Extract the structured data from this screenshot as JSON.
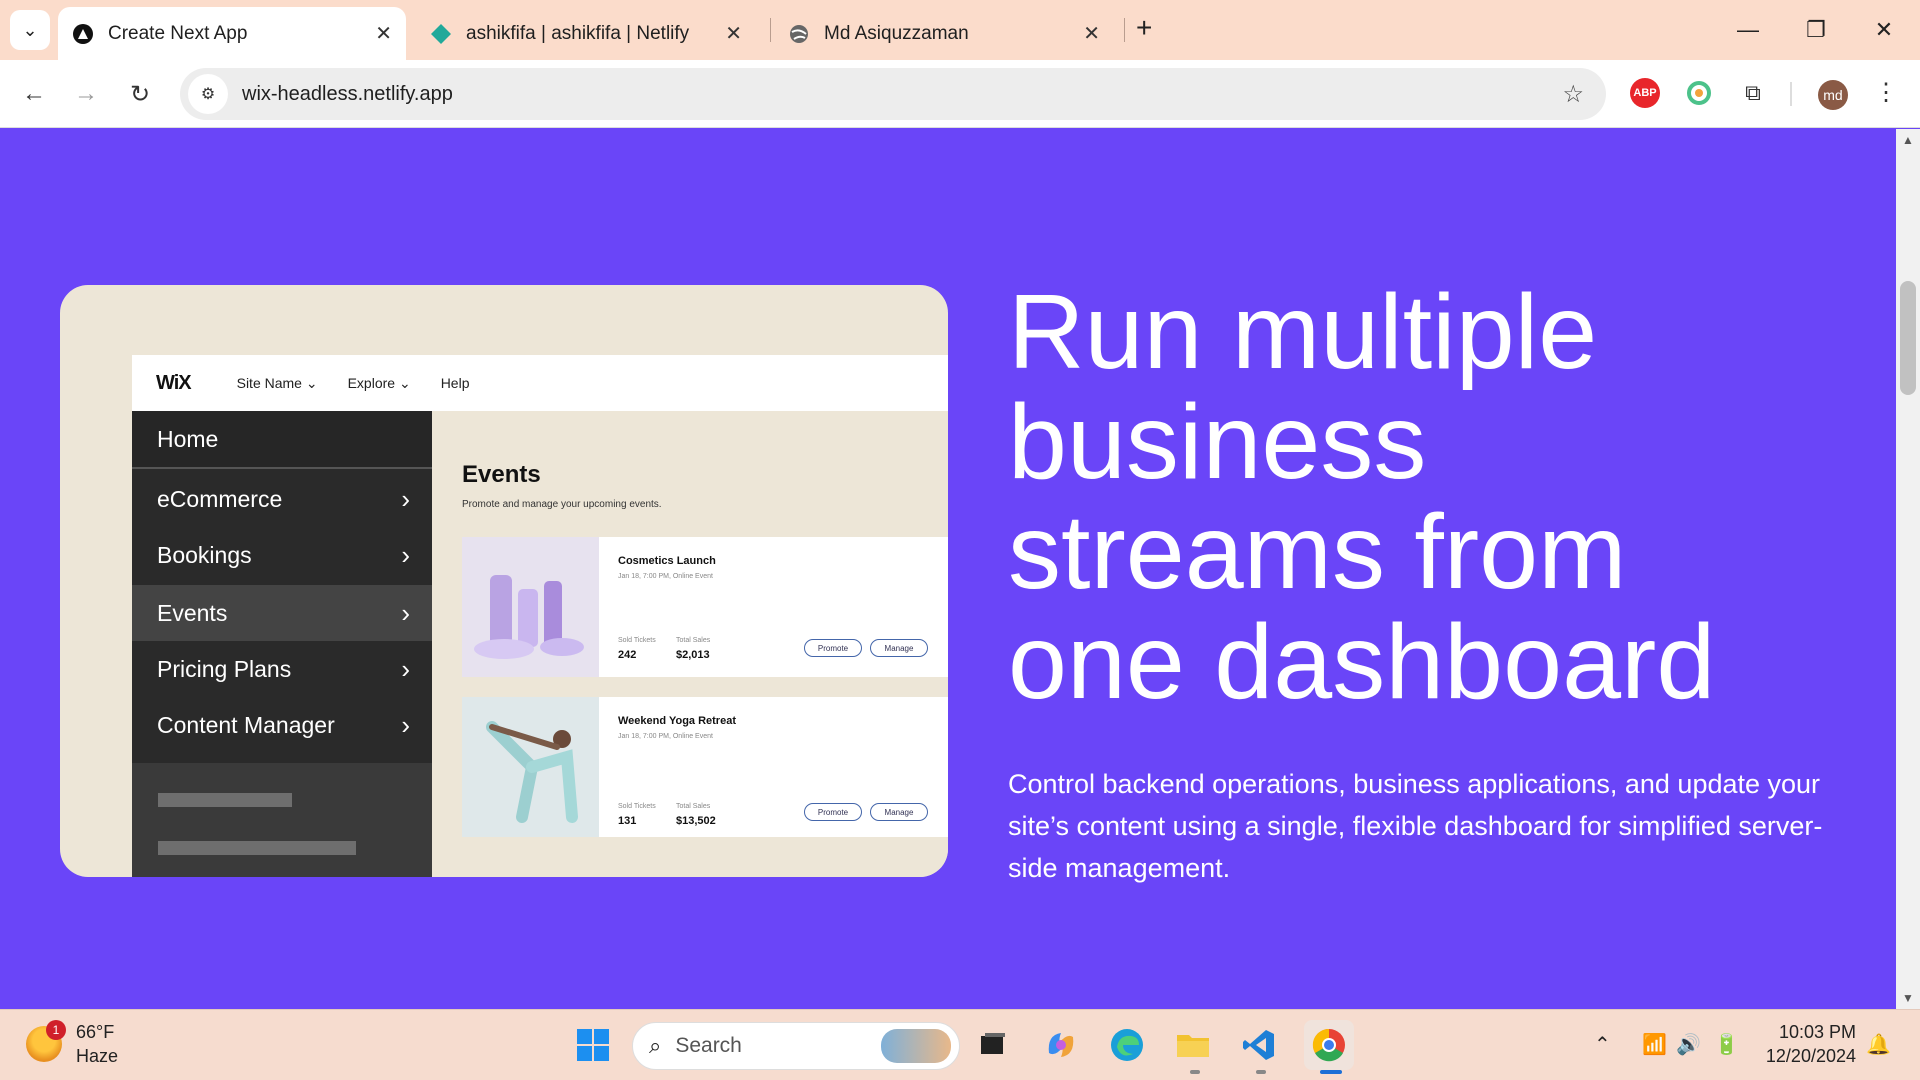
{
  "browser": {
    "tabs": [
      {
        "title": "Create Next App",
        "icon": "nextjs-icon",
        "active": true
      },
      {
        "title": "ashikfifa | ashikfifa | Netlify",
        "icon": "netlify-icon",
        "active": false
      },
      {
        "title": "Md Asiquzzaman",
        "icon": "globe-icon",
        "active": false
      }
    ],
    "url": "wix-headless.netlify.app",
    "profile_initials": "md",
    "extension_abp": "ABP"
  },
  "mockup": {
    "logo": "WiX",
    "nav": [
      "Site Name ⌄",
      "Explore ⌄",
      "Help"
    ],
    "sidebar": [
      "Home",
      "eCommerce",
      "Bookings",
      "Events",
      "Pricing Plans",
      "Content Manager"
    ],
    "events_title": "Events",
    "events_subtitle": "Promote and manage your upcoming events.",
    "events": [
      {
        "name": "Cosmetics Launch",
        "date": "Jan 18, 7:00 PM, Online Event",
        "sold_label": "Sold Tickets",
        "sold": "242",
        "sales_label": "Total Sales",
        "sales": "$2,013",
        "promote": "Promote",
        "manage": "Manage"
      },
      {
        "name": "Weekend Yoga Retreat",
        "date": "Jan 18, 7:00 PM, Online Event",
        "sold_label": "Sold Tickets",
        "sold": "131",
        "sales_label": "Total Sales",
        "sales": "$13,502",
        "promote": "Promote",
        "manage": "Manage"
      }
    ]
  },
  "hero": {
    "title": "Run multiple business streams from one dashboard",
    "description": "Control backend operations, business applications, and update your site’s content using a single, flexible dashboard for simplified server-side management."
  },
  "taskbar": {
    "weather_temp": "66°F",
    "weather_cond": "Haze",
    "weather_badge": "1",
    "search_placeholder": "Search",
    "time": "10:03 PM",
    "date": "12/20/2024"
  },
  "colors": {
    "page_bg": "#6a45f8",
    "tabstrip_bg": "#fbdccb",
    "taskbar_bg": "#f6dccf"
  }
}
